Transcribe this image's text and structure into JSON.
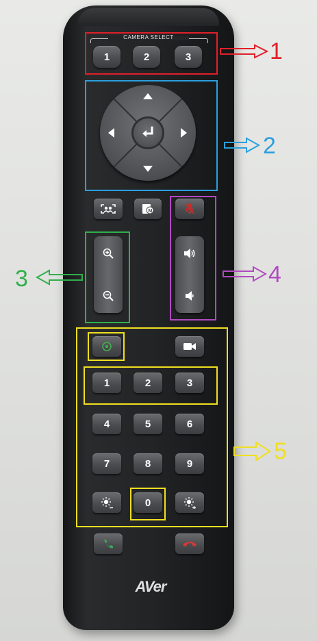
{
  "remote": {
    "camera_select_label": "CAMERA SELECT",
    "camera_buttons": [
      "1",
      "2",
      "3"
    ],
    "keypad": {
      "row1": [
        "1",
        "2",
        "3"
      ],
      "row2": [
        "4",
        "5",
        "6"
      ],
      "row3": [
        "7",
        "8",
        "9"
      ],
      "zero": "0"
    },
    "brand": "AVer",
    "icons": {
      "dpad": [
        "arrow-up-icon",
        "arrow-down-icon",
        "arrow-left-icon",
        "arrow-right-icon",
        "enter-icon"
      ],
      "function_row": [
        "auto-frame-icon",
        "memory-icon",
        "mic-mute-icon"
      ],
      "zoom": [
        "zoom-in-icon",
        "zoom-out-icon"
      ],
      "volume": [
        "volume-up-icon",
        "volume-down-icon"
      ],
      "misc": [
        "snapshot-icon",
        "camera-icon",
        "brightness-down-icon",
        "brightness-up-icon",
        "call-answer-icon",
        "call-end-icon"
      ]
    }
  },
  "annotations": [
    {
      "label": "1",
      "color": "#e0202a"
    },
    {
      "label": "2",
      "color": "#2a9fe0"
    },
    {
      "label": "3",
      "color": "#2fb04a"
    },
    {
      "label": "4",
      "color": "#b04ac0"
    },
    {
      "label": "5",
      "color": "#f0e020"
    }
  ],
  "colors": {
    "mic_mute": "#c0302e",
    "call_answer": "#3fa85a",
    "call_end": "#d23a36",
    "snapshot": "#43b04f"
  }
}
